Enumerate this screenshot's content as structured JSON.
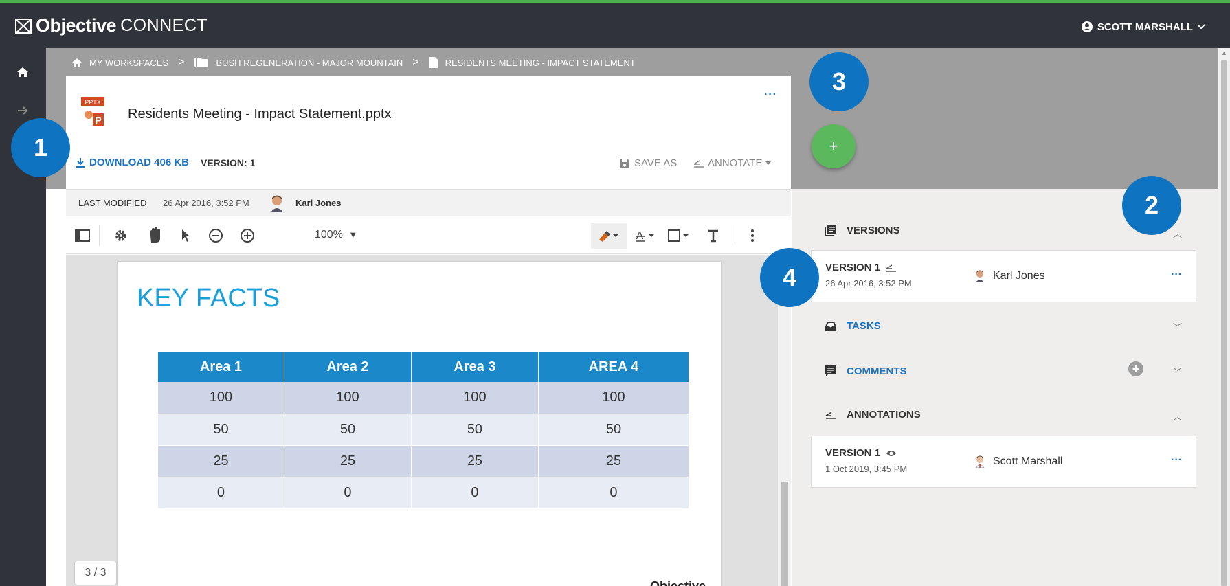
{
  "app": {
    "brand": "Objective",
    "product": "CONNECT",
    "accent_color": "#4caf50",
    "header_color": "#30343a"
  },
  "user": {
    "name": "SCOTT MARSHALL",
    "icon": "account-circle-icon"
  },
  "breadcrumb": {
    "items": [
      {
        "label": "MY WORKSPACES",
        "icon": "home-icon"
      },
      {
        "label": "BUSH REGENERATION - MAJOR MOUNTAIN",
        "icon": "folder-icon"
      },
      {
        "label": "RESIDENTS MEETING - IMPACT STATEMENT",
        "icon": "file-icon"
      }
    ],
    "separator": ">"
  },
  "document": {
    "title": "Residents Meeting - Impact Statement.pptx",
    "file_badge": "PPTX",
    "more": "···",
    "download_label": "DOWNLOAD 406 KB",
    "version_label": "VERSION: 1",
    "save_as_label": "SAVE AS",
    "annotate_label": "ANNOTATE",
    "last_modified_label": "LAST MODIFIED",
    "last_modified_date": "26 Apr 2016, 3:52 PM",
    "modified_by": "Karl Jones"
  },
  "viewer_toolbar": {
    "zoom": "100%"
  },
  "slide": {
    "title": "KEY FACTS",
    "table": {
      "headers": [
        "Area 1",
        "Area 2",
        "Area 3",
        "AREA 4"
      ],
      "rows": [
        [
          "100",
          "100",
          "100",
          "100"
        ],
        [
          "50",
          "50",
          "50",
          "50"
        ],
        [
          "25",
          "25",
          "25",
          "25"
        ],
        [
          "0",
          "0",
          "0",
          "0"
        ]
      ]
    },
    "footer_logo": "Objective"
  },
  "page_indicator": "3 / 3",
  "fab": {
    "label": "+"
  },
  "callouts": [
    "1",
    "2",
    "3",
    "4"
  ],
  "side_panel": {
    "versions": {
      "title": "VERSIONS",
      "items": [
        {
          "label": "VERSION 1",
          "date": "26 Apr 2016, 3:52 PM",
          "user": "Karl Jones",
          "more": "···"
        }
      ]
    },
    "tasks": {
      "title": "TASKS"
    },
    "comments": {
      "title": "COMMENTS",
      "add": "+"
    },
    "annotations": {
      "title": "ANNOTATIONS",
      "items": [
        {
          "label": "VERSION 1",
          "date": "1 Oct 2019, 3:45 PM",
          "user": "Scott Marshall",
          "more": "···"
        }
      ]
    }
  }
}
